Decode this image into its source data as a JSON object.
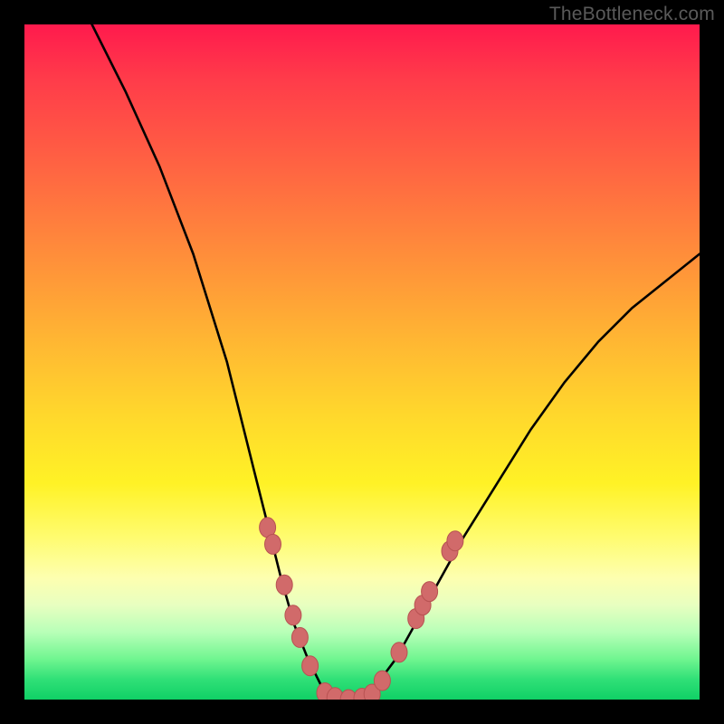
{
  "watermark": "TheBottleneck.com",
  "chart_data": {
    "type": "line",
    "title": "",
    "xlabel": "",
    "ylabel": "",
    "xlim": [
      0,
      100
    ],
    "ylim": [
      0,
      100
    ],
    "series": [
      {
        "name": "bottleneck-curve",
        "x": [
          10,
          15,
          20,
          25,
          30,
          32,
          34,
          36,
          38,
          40,
          42,
          44,
          46,
          48,
          50,
          52,
          55,
          60,
          65,
          70,
          75,
          80,
          85,
          90,
          95,
          100
        ],
        "values": [
          100,
          90,
          79,
          66,
          50,
          42,
          34,
          26,
          18,
          11,
          6,
          2,
          0,
          0,
          0,
          2,
          6,
          15,
          24,
          32,
          40,
          47,
          53,
          58,
          62,
          66
        ]
      }
    ],
    "markers": [
      {
        "x": 36.0,
        "y": 25.5
      },
      {
        "x": 36.8,
        "y": 23.0
      },
      {
        "x": 38.5,
        "y": 17.0
      },
      {
        "x": 39.8,
        "y": 12.5
      },
      {
        "x": 40.8,
        "y": 9.2
      },
      {
        "x": 42.3,
        "y": 5.0
      },
      {
        "x": 44.5,
        "y": 1.0
      },
      {
        "x": 46.0,
        "y": 0.3
      },
      {
        "x": 48.0,
        "y": 0.0
      },
      {
        "x": 50.0,
        "y": 0.2
      },
      {
        "x": 51.5,
        "y": 0.8
      },
      {
        "x": 53.0,
        "y": 2.8
      },
      {
        "x": 55.5,
        "y": 7.0
      },
      {
        "x": 58.0,
        "y": 12.0
      },
      {
        "x": 59.0,
        "y": 14.0
      },
      {
        "x": 60.0,
        "y": 16.0
      },
      {
        "x": 63.0,
        "y": 22.0
      },
      {
        "x": 63.8,
        "y": 23.5
      }
    ],
    "colors": {
      "curve": "#000000",
      "marker_fill": "#d16a6a",
      "marker_stroke": "#b85252"
    }
  }
}
